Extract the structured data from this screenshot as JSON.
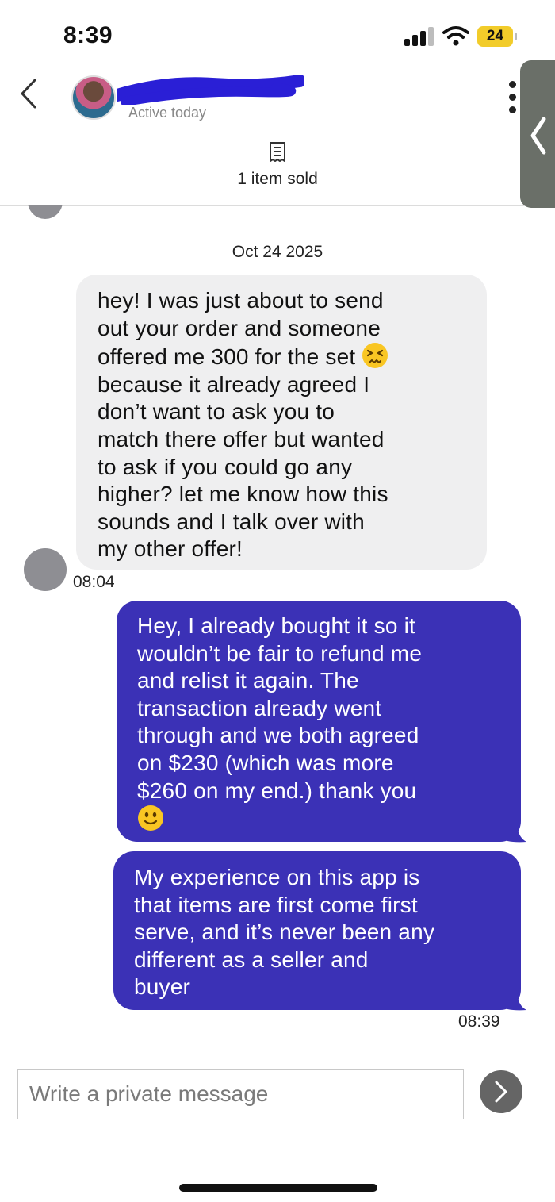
{
  "status_bar": {
    "time": "8:39",
    "battery": "24",
    "icons": [
      "signal-icon",
      "wifi-icon",
      "battery-icon"
    ]
  },
  "header": {
    "contact_status": "Active today",
    "items_sold": "1 item sold",
    "icons": [
      "back-chevron-icon",
      "more-vertical-icon",
      "receipt-icon"
    ]
  },
  "conversation": {
    "date": "Oct 24 2025",
    "messages": [
      {
        "direction": "incoming",
        "lines": [
          "hey! I was just about to send",
          "out your order and someone",
          "offered me 300 for the set",
          "because it already agreed I",
          "don’t want to ask you to",
          "match there offer but wanted",
          "to ask if you could go any",
          "higher? let me know how this",
          "sounds and I talk over with",
          "my other offer!"
        ],
        "emoji": "persevering-face",
        "time": "08:04"
      },
      {
        "direction": "outgoing",
        "lines": [
          "Hey, I already bought it so it",
          "wouldn’t be fair to refund me",
          "and relist it again. The",
          "transaction already went",
          "through and we both agreed",
          "on $230 (which was more",
          "$260 on my end.) thank you"
        ],
        "emoji": "slightly-smiling-face"
      },
      {
        "direction": "outgoing",
        "lines": [
          "My experience on this app is",
          "that items are first come first",
          "serve, and it’s never been any",
          "different as a seller and",
          "buyer"
        ],
        "time": "08:39"
      }
    ]
  },
  "composer": {
    "placeholder": "Write a private message"
  },
  "colors": {
    "outgoing_bubble": "#3b31b6",
    "incoming_bubble": "#efeff0",
    "battery": "#f2cc2a",
    "send_button": "#656565"
  }
}
